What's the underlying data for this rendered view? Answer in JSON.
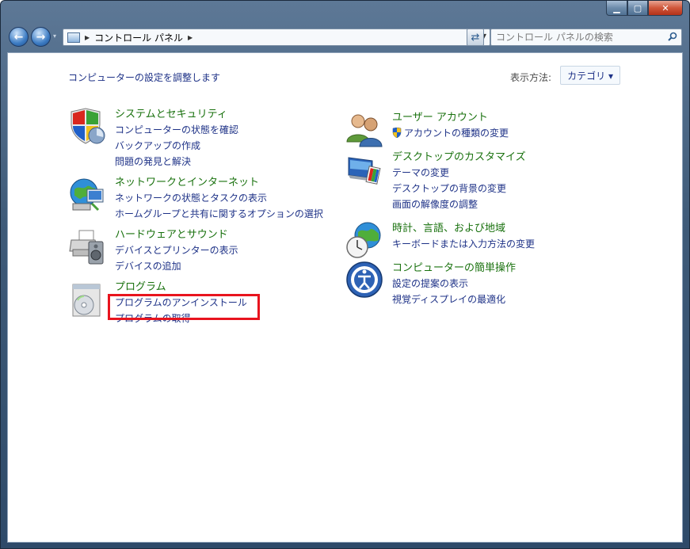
{
  "window": {
    "controls": {
      "minimize": "▁",
      "maximize": "▢",
      "close": "✕"
    }
  },
  "address": {
    "breadcrumb": "コントロール パネル"
  },
  "search": {
    "placeholder": "コントロール パネルの検索"
  },
  "content": {
    "heading": "コンピューターの設定を調整します",
    "view_by_label": "表示方法:",
    "view_by_value": "カテゴリ ▾"
  },
  "categories_left": [
    {
      "title": "システムとセキュリティ",
      "links": [
        "コンピューターの状態を確認",
        "バックアップの作成",
        "問題の発見と解決"
      ]
    },
    {
      "title": "ネットワークとインターネット",
      "links": [
        "ネットワークの状態とタスクの表示",
        "ホームグループと共有に関するオプションの選択"
      ]
    },
    {
      "title": "ハードウェアとサウンド",
      "links": [
        "デバイスとプリンターの表示",
        "デバイスの追加"
      ]
    },
    {
      "title": "プログラム",
      "links": [
        "プログラムのアンインストール",
        "プログラムの取得"
      ]
    }
  ],
  "categories_right": [
    {
      "title": "ユーザー アカウント",
      "links": [
        "アカウントの種類の変更"
      ]
    },
    {
      "title": "デスクトップのカスタマイズ",
      "links": [
        "テーマの変更",
        "デスクトップの背景の変更",
        "画面の解像度の調整"
      ]
    },
    {
      "title": "時計、言語、および地域",
      "links": [
        "キーボードまたは入力方法の変更"
      ]
    },
    {
      "title": "コンピューターの簡単操作",
      "links": [
        "設定の提案の表示",
        "視覚ディスプレイの最適化"
      ]
    }
  ],
  "colors": {
    "category_title": "#19710e",
    "link": "#1e3287",
    "highlight": "#e8141e"
  }
}
